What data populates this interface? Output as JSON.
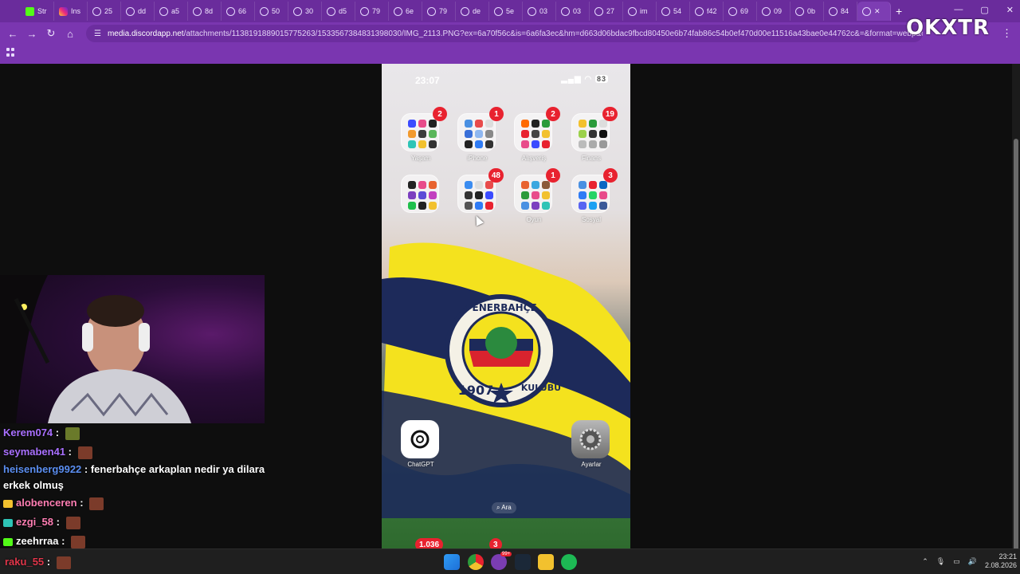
{
  "browser": {
    "tabs": [
      {
        "label": "Str",
        "kind": "kick"
      },
      {
        "label": "Ins",
        "kind": "insta"
      },
      {
        "label": "25",
        "kind": "generic"
      },
      {
        "label": "dd",
        "kind": "generic"
      },
      {
        "label": "a5",
        "kind": "generic"
      },
      {
        "label": "8d",
        "kind": "generic"
      },
      {
        "label": "66",
        "kind": "generic"
      },
      {
        "label": "50",
        "kind": "generic"
      },
      {
        "label": "30",
        "kind": "generic"
      },
      {
        "label": "d5",
        "kind": "generic"
      },
      {
        "label": "79",
        "kind": "generic"
      },
      {
        "label": "6e",
        "kind": "generic"
      },
      {
        "label": "79",
        "kind": "generic"
      },
      {
        "label": "de",
        "kind": "generic"
      },
      {
        "label": "5e",
        "kind": "generic"
      },
      {
        "label": "03",
        "kind": "generic"
      },
      {
        "label": "03",
        "kind": "generic"
      },
      {
        "label": "27",
        "kind": "generic"
      },
      {
        "label": "im",
        "kind": "generic"
      },
      {
        "label": "54",
        "kind": "generic"
      },
      {
        "label": "f42",
        "kind": "generic"
      },
      {
        "label": "69",
        "kind": "generic"
      },
      {
        "label": "09",
        "kind": "generic"
      },
      {
        "label": "0b",
        "kind": "generic"
      },
      {
        "label": "84",
        "kind": "generic"
      }
    ],
    "url_host": "media.discordapp.net",
    "url_path": "/attachments/1138191889015775263/1533567384831398030/IMG_2113.PNG?ex=6a70f56c&is=6a6fa3ec&hm=d663d06bdac9fbcd80450e6b74fab86c54b0ef470d00e11516a43bae0e44762c&=&format=webp&qualit...",
    "new_tab": "+",
    "watermark": "OKXTR"
  },
  "phone": {
    "time": "23:07",
    "battery": "83",
    "folders_row1": [
      {
        "label": "Yaşam",
        "badge": "2"
      },
      {
        "label": "iPhone",
        "badge": "1"
      },
      {
        "label": "Alışveriş",
        "badge": "2"
      },
      {
        "label": "Finans",
        "badge": "19"
      }
    ],
    "folders_row2": [
      {
        "label": "",
        "badge": ""
      },
      {
        "label": "",
        "badge": "48"
      },
      {
        "label": "Oyun",
        "badge": "1"
      },
      {
        "label": "Sosyal",
        "badge": "3"
      }
    ],
    "flag_text_top": "FENERBAHÇE",
    "flag_year": "1907",
    "flag_text_right": "KULÜBÜ",
    "chatgpt_label": "ChatGPT",
    "settings_label": "Ayarlar",
    "search_label": "⌕ Ara",
    "dock_badge_1": "1.036",
    "dock_badge_2": "3"
  },
  "chat": [
    {
      "user": "Kerem074",
      "color": "#a970ff",
      "text": "",
      "emote": "leaf"
    },
    {
      "user": "seymaben41",
      "color": "#a970ff",
      "text": "",
      "emote": "face"
    },
    {
      "user": "heisenberg9922",
      "color": "#5b8ef0",
      "text": "fenerbahçe arkaplan nedir ya dilara erkek olmuş",
      "emote": ""
    },
    {
      "user": "alobenceren",
      "color": "#ff7eb3",
      "text": "",
      "emote": "face"
    },
    {
      "user": "ezgi_58",
      "color": "#ff7eb3",
      "text": "",
      "emote": "face"
    },
    {
      "user": "zeehrraa",
      "color": "#ffffff",
      "text": "",
      "emote": "face"
    },
    {
      "user": "raku_55",
      "color": "#e0364a",
      "text": "",
      "emote": "face"
    }
  ],
  "taskbar": {
    "time": "23:21",
    "date": "2.08.2026",
    "chrome_badge": "",
    "discord_badge": "99+"
  }
}
